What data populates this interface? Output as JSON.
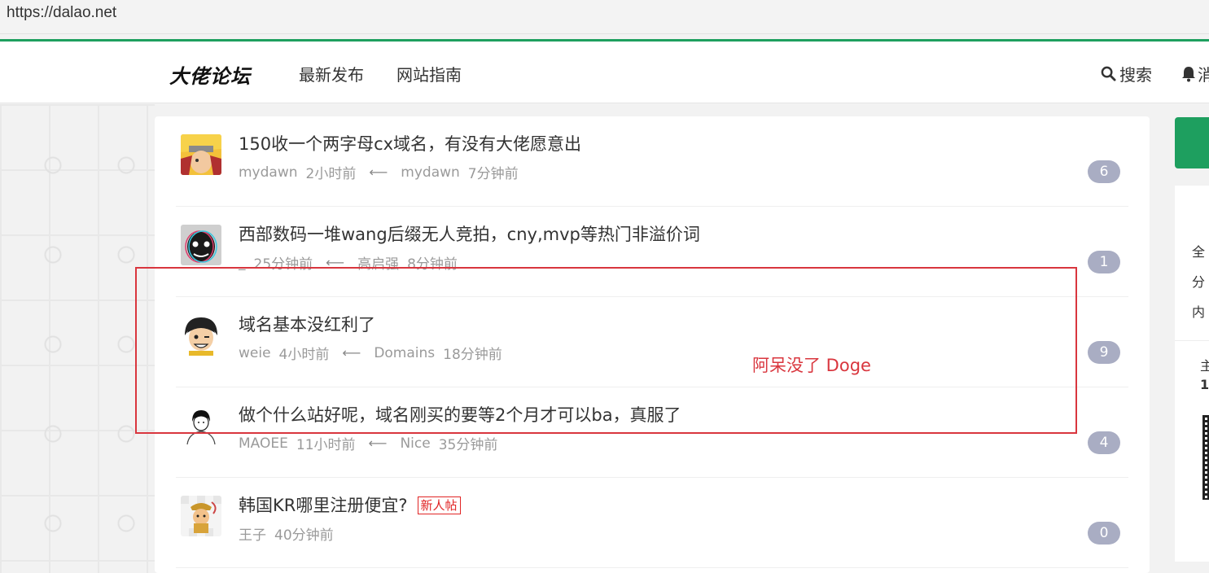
{
  "browser": {
    "url": "https://dalao.net"
  },
  "header": {
    "logo": "大佬论坛",
    "nav": [
      {
        "label": "最新发布"
      },
      {
        "label": "网站指南"
      }
    ],
    "search_label": "搜索",
    "notice_label": "消"
  },
  "topics": [
    {
      "title": "150收一个两字母cx域名，有没有大佬愿意出",
      "author": "mydawn",
      "posted": "2小时前",
      "last_replier": "mydawn",
      "last_reply": "7分钟前",
      "count": "6",
      "avatar": "orange-ninja-avatar",
      "tag": ""
    },
    {
      "title": "西部数码一堆wang后缀无人竞拍，cny,mvp等热门非溢价词",
      "author": "_",
      "posted": "25分钟前",
      "last_replier": "高启强",
      "last_reply": "8分钟前",
      "count": "1",
      "avatar": "glitch-face-avatar",
      "tag": ""
    },
    {
      "title": "域名基本没红利了",
      "author": "weie",
      "posted": "4小时前",
      "last_replier": "Domains",
      "last_reply": "18分钟前",
      "count": "9",
      "avatar": "cartoon-boy-avatar",
      "tag": ""
    },
    {
      "title": "做个什么站好呢，域名刚买的要等2个月才可以ba，真服了",
      "author": "MAOEE",
      "posted": "11小时前",
      "last_replier": "Nice",
      "last_reply": "35分钟前",
      "count": "4",
      "avatar": "sketch-person-avatar",
      "tag": ""
    },
    {
      "title": "韩国KR哪里注册便宜?",
      "author": "王子",
      "posted": "40分钟前",
      "last_replier": "",
      "last_reply": "",
      "count": "0",
      "avatar": "monkey-king-avatar",
      "tag": "新人帖"
    }
  ],
  "annotation": {
    "text": "阿呆没了 Doge",
    "color": "#d9363e"
  },
  "sidebar": {
    "lines": [
      "全",
      "分",
      "内",
      "主",
      "1"
    ]
  },
  "colors": {
    "brand_green": "#1e9f5f",
    "badge": "#a9adc3",
    "new_tag": "#e12525"
  }
}
